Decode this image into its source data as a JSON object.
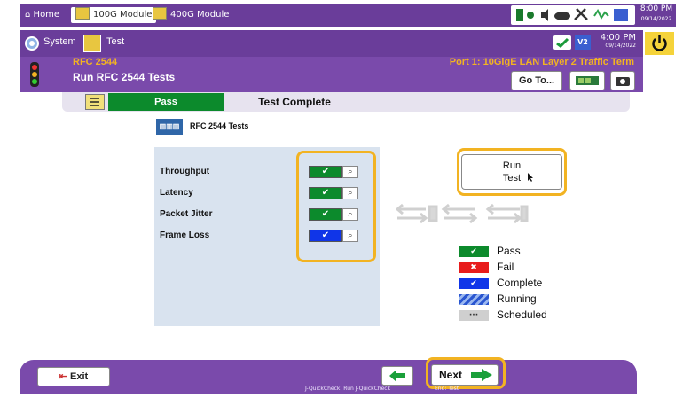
{
  "topbar": {
    "home": "Home",
    "tabs": [
      "100G Module",
      "400G Module"
    ],
    "clock_time": "8:00 PM",
    "clock_date": "09/14/2022",
    "gps": "GPS"
  },
  "sysbar": {
    "system": "System",
    "test": "Test",
    "time": "4:00 PM",
    "date": "09/14/2022",
    "v2": "V2"
  },
  "header": {
    "test_name": "RFC 2544",
    "subtitle": "Run RFC 2544 Tests",
    "port": "Port 1: 10GigE LAN Layer 2 Traffic Term",
    "goto": "Go To..."
  },
  "result": {
    "status": "Pass",
    "message": "Test Complete"
  },
  "panel": {
    "title": "RFC 2544 Tests",
    "tests": [
      {
        "label": "Throughput",
        "status": "pass",
        "color": "#0c8a2c"
      },
      {
        "label": "Latency",
        "status": "pass",
        "color": "#0c8a2c"
      },
      {
        "label": "Packet Jitter",
        "status": "pass",
        "color": "#0c8a2c"
      },
      {
        "label": "Frame Loss",
        "status": "complete",
        "color": "#1035e8"
      }
    ],
    "run_line1": "Run",
    "run_line2": "Test"
  },
  "legend": [
    {
      "label": "Pass",
      "color": "#0c8a2c",
      "glyph": "✔"
    },
    {
      "label": "Fail",
      "color": "#e81c1c",
      "glyph": "✖"
    },
    {
      "label": "Complete",
      "color": "#1035e8",
      "glyph": "✔"
    },
    {
      "label": "Running",
      "color": "#5a8be0",
      "glyph": ""
    },
    {
      "label": "Scheduled",
      "color": "#cfcfcf",
      "glyph": "···"
    }
  ],
  "bottom": {
    "exit": "Exit",
    "next": "Next",
    "back_caption": "J-QuickCheck: Run J-QuickCheck",
    "next_caption": "End: Test"
  },
  "colors": {
    "purple": "#7a4aab",
    "highlight": "#f2b322"
  }
}
